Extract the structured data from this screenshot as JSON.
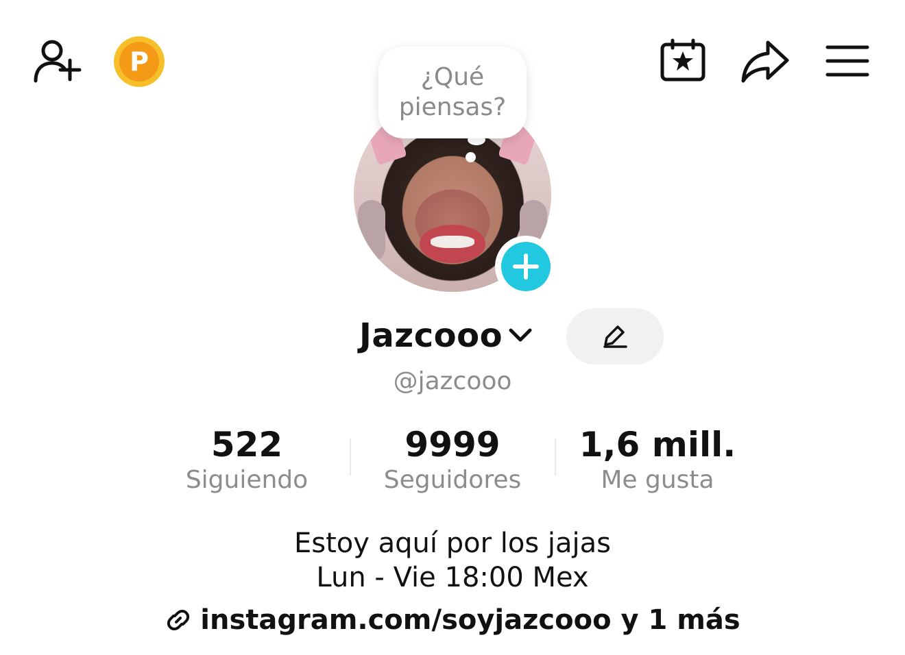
{
  "header": {
    "left_icons": [
      "add-friend-icon",
      "points-icon"
    ],
    "points_badge_letter": "P",
    "right_icons": [
      "calendar-star-icon",
      "share-icon",
      "menu-icon"
    ]
  },
  "thought_bubble": {
    "line1": "¿Qué",
    "line2": "piensas?"
  },
  "profile": {
    "display_name": "Jazcooo",
    "username": "@jazcooo",
    "accent_color": "#22c7e0"
  },
  "stats": [
    {
      "value": "522",
      "label": "Siguiendo"
    },
    {
      "value": "9999",
      "label": "Seguidores"
    },
    {
      "value": "1,6 mill.",
      "label": "Me gusta"
    }
  ],
  "bio": {
    "line1": "Estoy aquí por los jajas",
    "line2": "Lun - Vie 18:00 Mex"
  },
  "link": {
    "text": "instagram.com/soyjazcooo y 1 más",
    "icon": "link-icon"
  }
}
